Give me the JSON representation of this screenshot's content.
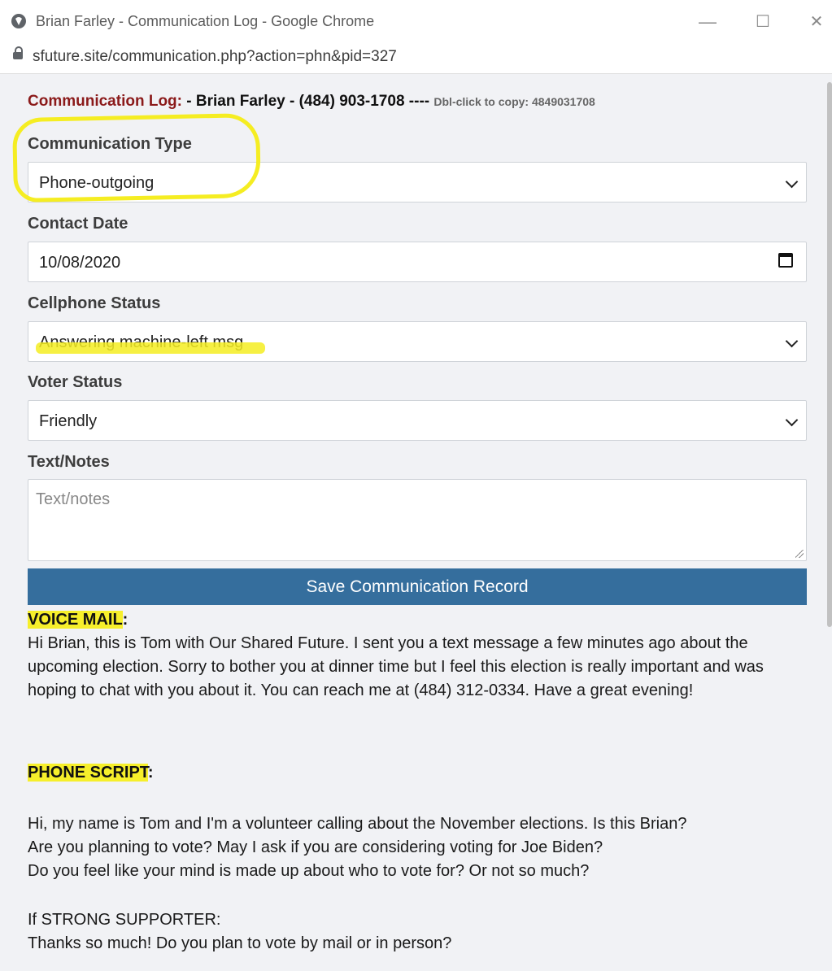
{
  "window": {
    "title": "Brian Farley - Communication Log - Google Chrome",
    "minimize": "—",
    "maximize": "☐",
    "close": "✕"
  },
  "address_bar": {
    "url": "sfuture.site/communication.php?action=phn&pid=327"
  },
  "header": {
    "label": "Communication Log:",
    "contact": "- Brian Farley - (484) 903-1708 ----",
    "copy_hint": "Dbl-click to copy: 4849031708"
  },
  "form": {
    "communication_type": {
      "label": "Communication Type",
      "value": "Phone-outgoing"
    },
    "contact_date": {
      "label": "Contact Date",
      "value": "10/08/2020"
    },
    "cellphone_status": {
      "label": "Cellphone Status",
      "value": "Answering machine-left msg"
    },
    "voter_status": {
      "label": "Voter Status",
      "value": "Friendly"
    },
    "notes": {
      "label": "Text/Notes",
      "placeholder": "Text/notes"
    },
    "save_label": "Save Communication Record"
  },
  "voicemail": {
    "heading_highlight": "VOICE MAIL",
    "heading_suffix": ":",
    "text": "Hi Brian, this is Tom with Our Shared Future. I sent you a text message a few minutes ago about the upcoming election. Sorry to bother you at dinner time but I feel this election is really important and was hoping to chat with you about it. You can reach me at (484) 312-0334. Have a great evening!"
  },
  "phone_script": {
    "heading_highlight": "PHONE SCRIPT",
    "heading_suffix": ":",
    "line1": "Hi, my name is Tom and I'm a volunteer calling about the November elections. Is this Brian?",
    "line2": "Are you planning to vote? May I ask if you are considering voting for Joe Biden?",
    "line3": "Do you feel like your mind is made up about who to vote for? Or not so much?",
    "strong_label": "If STRONG SUPPORTER:",
    "strong_text": "Thanks so much! Do you plan to vote by mail or in person?"
  },
  "colors": {
    "save_button": "#356e9d",
    "header_label": "#8b1a1a",
    "highlight": "#f5ed22"
  }
}
